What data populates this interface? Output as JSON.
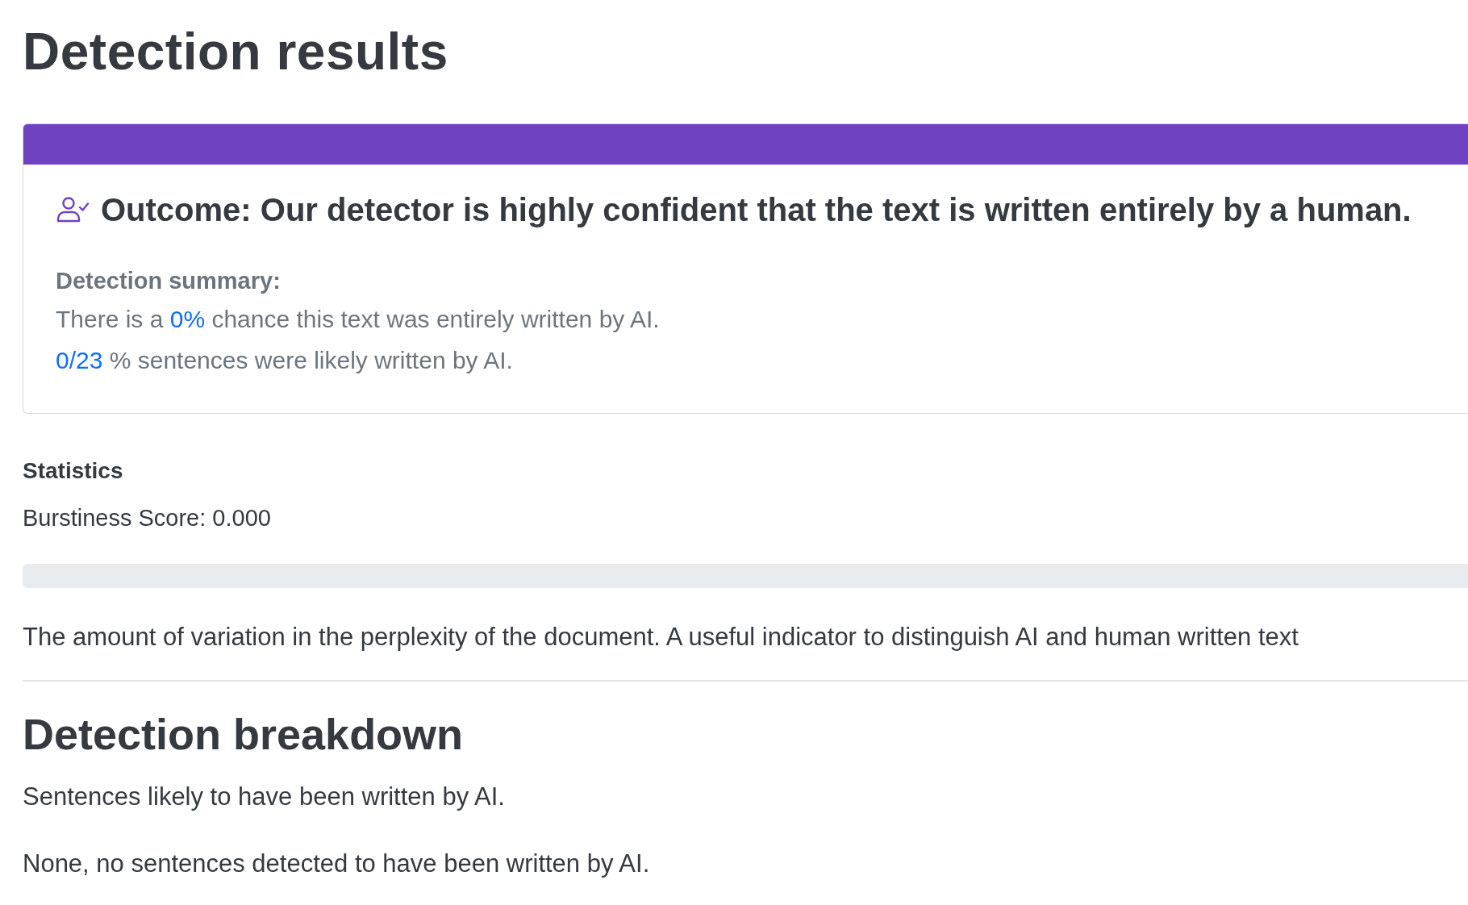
{
  "title": "Detection results",
  "outcome_card": {
    "heading": "Outcome: Our detector is highly confident that the text is written entirely by a human.",
    "summary_label": "Detection summary:",
    "summary_lines": [
      {
        "before": "There is a ",
        "highlight": "0%",
        "after": " chance this text was entirely written by AI."
      },
      {
        "highlight": "0/23",
        "after": " % sentences were likely written by AI."
      }
    ]
  },
  "statistics": {
    "heading": "Statistics",
    "score_label": "Burstiness Score: 0.000",
    "level": 0,
    "description": "The amount of variation in the perplexity of the document. A useful indicator to distinguish AI and human written text"
  },
  "breakdown": {
    "heading": "Detection breakdown",
    "intro": "Sentences likely to have been written by AI.",
    "result": "None, no sentences detected to have been written by AI."
  }
}
